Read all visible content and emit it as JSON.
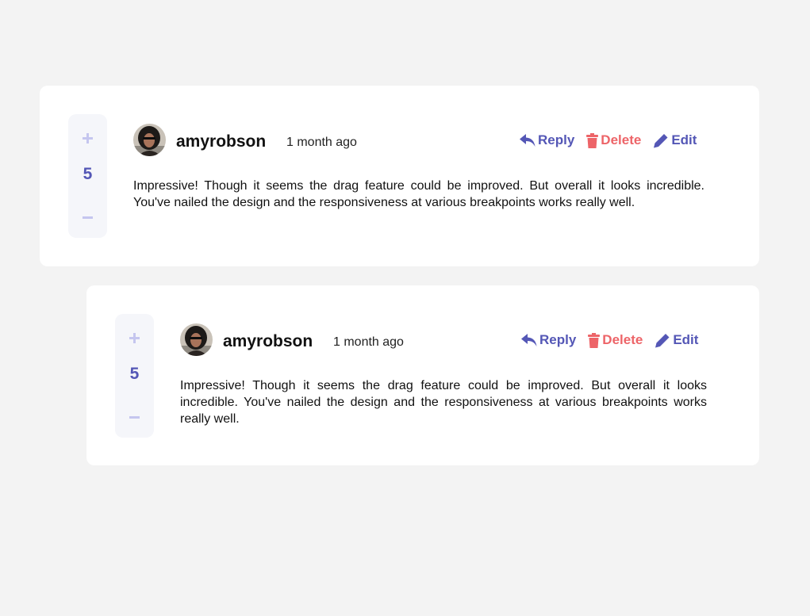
{
  "comments": [
    {
      "score": "5",
      "username": "amyrobson",
      "created_at": "1 month ago",
      "content": "Impressive! Though it seems the drag feature could be improved. But overall it looks incredible. You've nailed the design and the responsiveness at various breakpoints works really well.",
      "actions": {
        "reply": "Reply",
        "delete": "Delete",
        "edit": "Edit"
      }
    },
    {
      "score": "5",
      "username": "amyrobson",
      "created_at": "1 month ago",
      "content": "Impressive! Though it seems the drag feature could be improved. But overall it looks incredible. You've nailed the design and the responsiveness at various breakpoints works really well.",
      "actions": {
        "reply": "Reply",
        "delete": "Delete",
        "edit": "Edit"
      }
    }
  ],
  "icons": {
    "upvote": "plus-icon",
    "downvote": "minus-icon",
    "reply": "reply-icon",
    "delete": "trash-icon",
    "edit": "pencil-icon"
  },
  "colors": {
    "background": "#f3f3f3",
    "card": "#ffffff",
    "vote_panel": "#f5f6fa",
    "vote_icon": "#c5c6ef",
    "primary": "#5457b6",
    "danger": "#ed6468",
    "text": "#111111"
  }
}
